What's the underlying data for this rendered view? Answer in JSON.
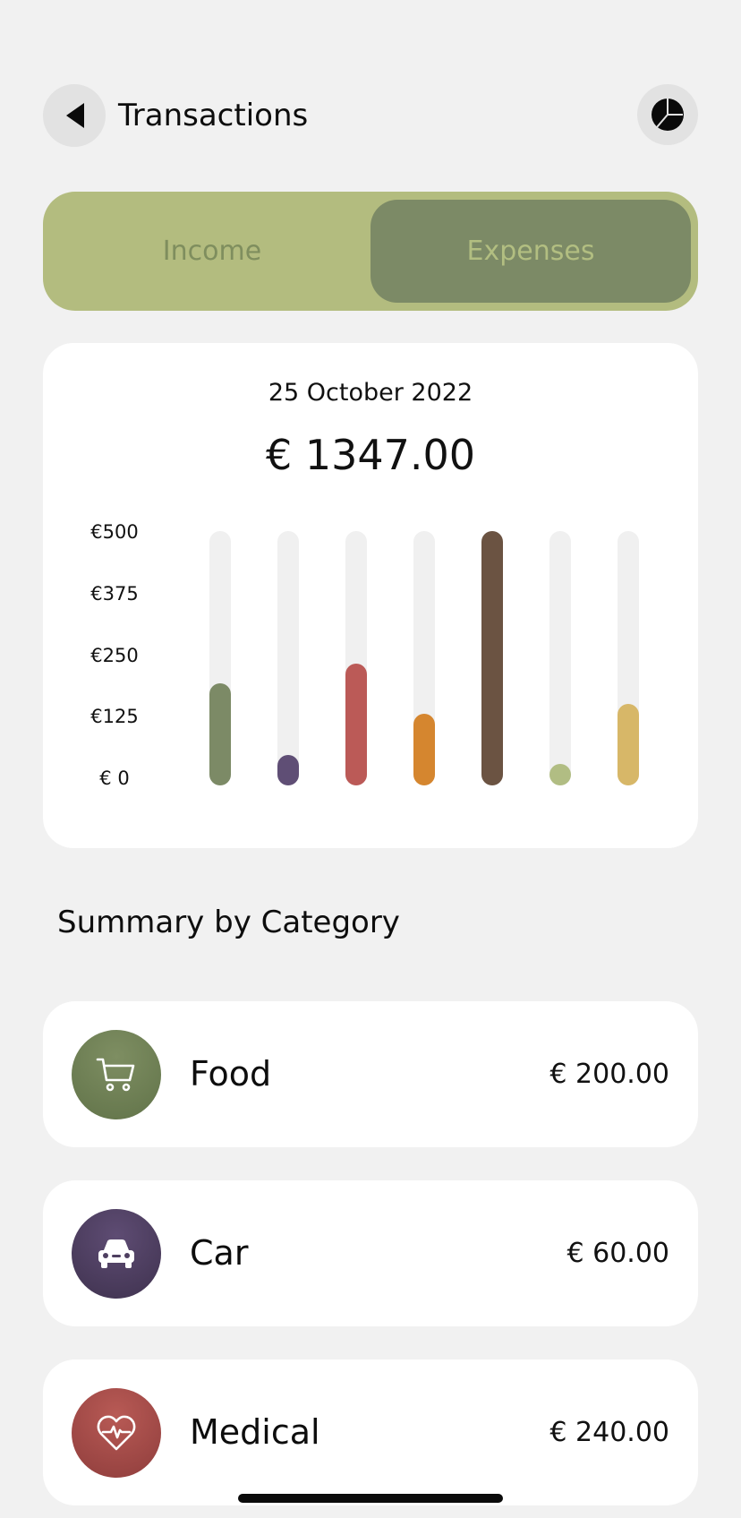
{
  "header": {
    "title": "Transactions",
    "back_icon": "back-triangle-icon",
    "chart_icon": "pie-chart-icon"
  },
  "tabs": [
    {
      "label": "Income",
      "selected": false
    },
    {
      "label": "Expenses",
      "selected": true
    }
  ],
  "summary": {
    "date": "25 October 2022",
    "total": "€ 1347.00"
  },
  "chart_data": {
    "type": "bar",
    "y_tick_labels": [
      "€500",
      "€375",
      "€250",
      "€125",
      "€ 0"
    ],
    "ylim": [
      0,
      500
    ],
    "values": [
      200,
      60,
      240,
      140,
      500,
      40,
      160
    ],
    "colors": [
      "#7c8a66",
      "#5f4e75",
      "#bb5a57",
      "#d5862f",
      "#6b5342",
      "#b1bd83",
      "#d7b768"
    ],
    "track_color": "#f0f0f0"
  },
  "section_title": "Summary by Category",
  "categories": [
    {
      "name": "Food",
      "amount": "€ 200.00",
      "icon": "cart-icon",
      "color": "#6f7f55"
    },
    {
      "name": "Car",
      "amount": "€ 60.00",
      "icon": "car-icon",
      "color": "#4e3f60"
    },
    {
      "name": "Medical",
      "amount": "€ 240.00",
      "icon": "heart-pulse-icon",
      "color": "#a64744"
    }
  ]
}
